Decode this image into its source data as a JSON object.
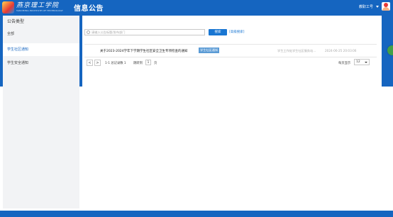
{
  "header": {
    "logo_text": "燕京理工学院",
    "logo_subtext": "YANCHING INSTITUTE OF TECHNOLOGY",
    "page_title": "信息公告",
    "user_name": "教职工号"
  },
  "sidebar": {
    "title": "公告类型",
    "items": [
      {
        "label": "全部",
        "active": false
      },
      {
        "label": "学生社区通知",
        "active": true
      },
      {
        "label": "学生安全通知",
        "active": false
      }
    ]
  },
  "search": {
    "placeholder": "请输入公告标题/发布部门",
    "button_label": "搜索",
    "advanced_label": "[高级搜索]"
  },
  "announcements": [
    {
      "title": "关于2023-2024学年下学期学生社区安全卫生专项检查的通知",
      "category": "学生社区通知",
      "source": "学生工作处学生社区服务站...",
      "date": "2024-06-25 20:03:06"
    }
  ],
  "pagination": {
    "prev": "<",
    "next": ">",
    "summary": "1-1 总记录数 1",
    "jump_label": "跳转到",
    "current_page": "1",
    "page_unit": "页",
    "per_page_label": "每页显示",
    "per_page_value": "12"
  },
  "colors": {
    "brand_blue": "#1565c0",
    "button_blue": "#1976d2",
    "badge_blue": "#5b9bd5",
    "sidebar_bg": "#f2f3f5"
  }
}
